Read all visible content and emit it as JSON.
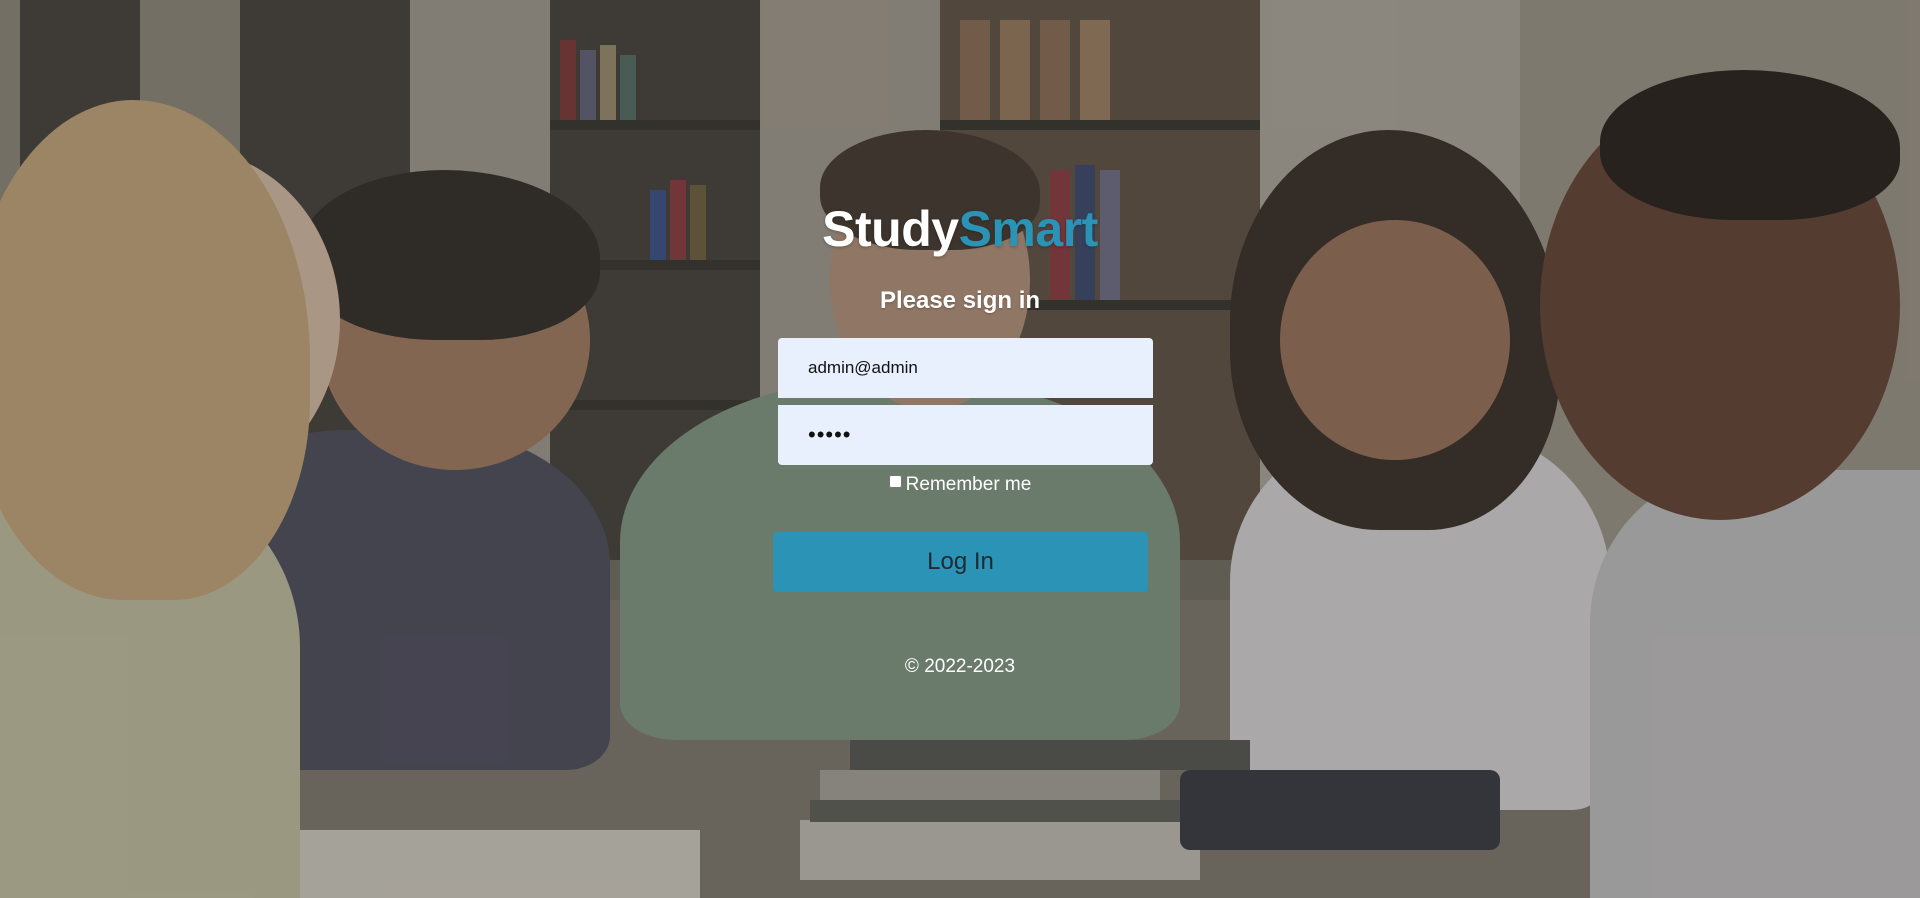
{
  "brand": {
    "part1": "Study",
    "part2": "Smart"
  },
  "form": {
    "title": "Please sign in",
    "email_value": "admin@admin",
    "password_value": "•••••",
    "remember_label": "Remember me",
    "remember_checked": false,
    "submit_label": "Log In"
  },
  "footer": {
    "copyright": "© 2022-2023"
  },
  "colors": {
    "accent": "#2a93b6",
    "field_bg": "#e8f0fe"
  }
}
